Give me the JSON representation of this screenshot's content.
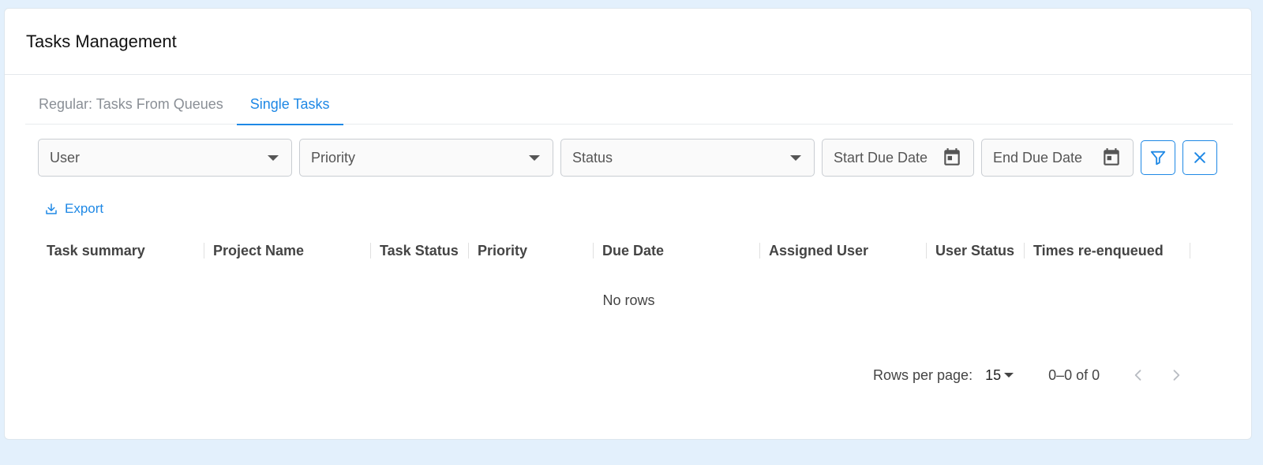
{
  "card": {
    "title": "Tasks Management"
  },
  "tabs": [
    {
      "label": "Regular: Tasks From Queues",
      "active": false
    },
    {
      "label": "Single Tasks",
      "active": true
    }
  ],
  "filters": {
    "user_placeholder": "User",
    "priority_placeholder": "Priority",
    "status_placeholder": "Status",
    "start_due_date_placeholder": "Start Due Date",
    "end_due_date_placeholder": "End Due Date",
    "filter_icon": "filter-icon",
    "clear_icon": "close-icon"
  },
  "export": {
    "label": "Export",
    "icon": "download-icon"
  },
  "grid": {
    "columns": [
      "Task summary",
      "Project Name",
      "Task Status",
      "Priority",
      "Due Date",
      "Assigned User",
      "User Status",
      "Times re-enqueued"
    ],
    "empty_text": "No rows"
  },
  "pagination": {
    "rows_per_page_label": "Rows per page:",
    "rows_per_page_value": "15",
    "range_text": "0–0 of 0"
  },
  "colors": {
    "accent": "#1e88e5",
    "background": "#e3f0fc"
  }
}
